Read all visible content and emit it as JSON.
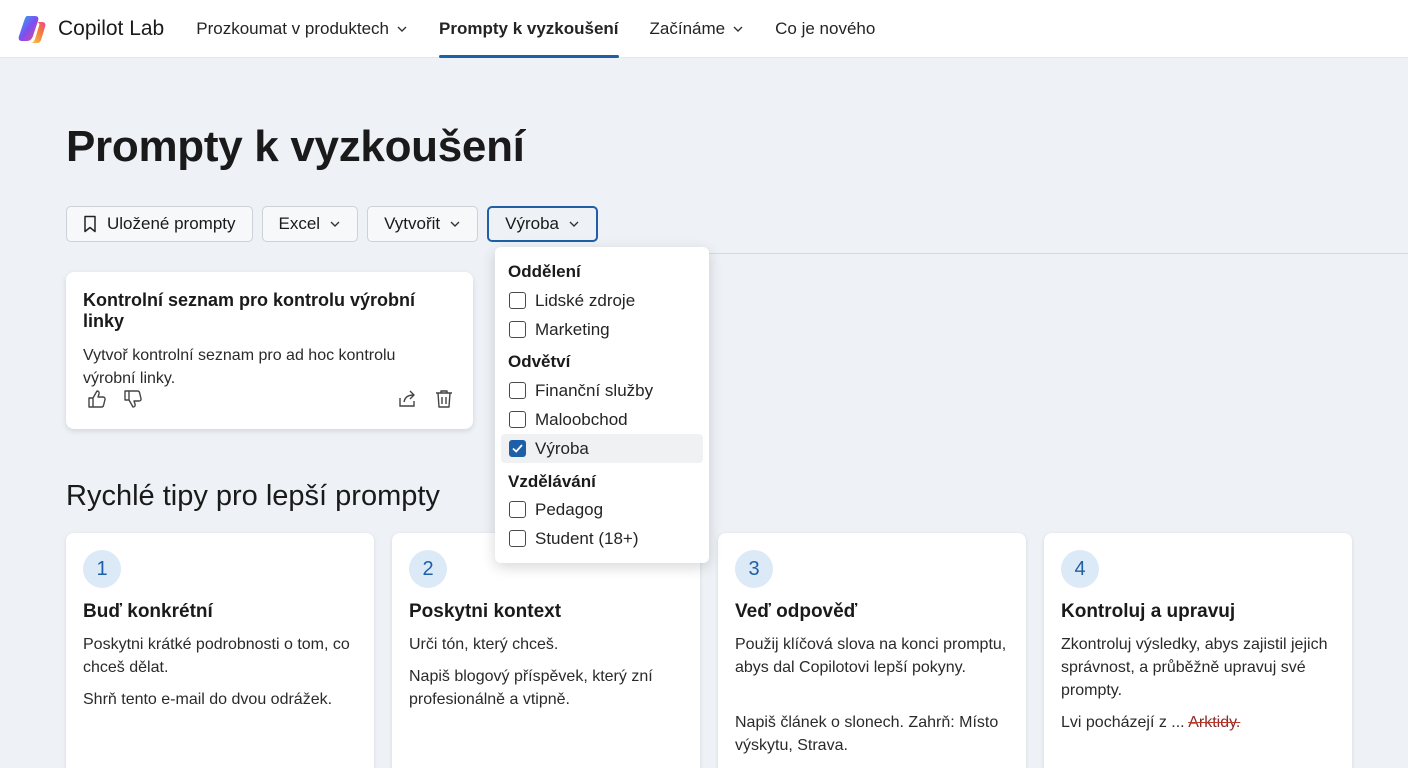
{
  "app": {
    "name": "Copilot Lab"
  },
  "nav": {
    "items": [
      {
        "label": "Prozkoumat v produktech",
        "has_menu": true,
        "active": false
      },
      {
        "label": "Prompty k vyzkoušení",
        "has_menu": false,
        "active": true
      },
      {
        "label": "Začínáme",
        "has_menu": true,
        "active": false
      },
      {
        "label": "Co je nového",
        "has_menu": false,
        "active": false
      }
    ]
  },
  "page": {
    "title": "Prompty k vyzkoušení"
  },
  "filters": {
    "saved_label": "Uložené prompty",
    "excel_label": "Excel",
    "create_label": "Vytvořit",
    "industry_label": "Výroba"
  },
  "dropdown": {
    "groups": [
      {
        "label": "Oddělení",
        "options": [
          {
            "label": "Lidské zdroje",
            "checked": false
          },
          {
            "label": "Marketing",
            "checked": false
          }
        ]
      },
      {
        "label": "Odvětví",
        "options": [
          {
            "label": "Finanční služby",
            "checked": false
          },
          {
            "label": "Maloobchod",
            "checked": false
          },
          {
            "label": "Výroba",
            "checked": true
          }
        ]
      },
      {
        "label": "Vzdělávání",
        "options": [
          {
            "label": "Pedagog",
            "checked": false
          },
          {
            "label": "Student (18+)",
            "checked": false
          }
        ]
      }
    ]
  },
  "prompt_card": {
    "title": "Kontrolní seznam pro kontrolu výrobní linky",
    "description": "Vytvoř kontrolní seznam pro ad hoc kontrolu výrobní linky."
  },
  "tips": {
    "title": "Rychlé tipy pro lepší prompty",
    "cards": [
      {
        "num": "1",
        "title": "Buď konkrétní",
        "text": "Poskytni krátké podrobnosti o tom, co chceš dělat.",
        "example": "Shrň tento e-mail do dvou odrážek."
      },
      {
        "num": "2",
        "title": "Poskytni kontext",
        "text": "Urči tón, který chceš.",
        "example": "Napiš blogový příspěvek, který zní profesionálně a vtipně."
      },
      {
        "num": "3",
        "title": "Veď odpověď",
        "text": "Použij klíčová slova na konci promptu, abys dal Copilotovi lepší pokyny.",
        "example": "Napiš článek o slonech. Zahrň: Místo výskytu, Strava."
      },
      {
        "num": "4",
        "title": "Kontroluj a upravuj",
        "text": "Zkontroluj výsledky, abys zajistil jejich správnost, a průběžně upravuj své prompty.",
        "example_prefix": "Lvi pocházejí z ... ",
        "example_struck": "Arktidy."
      }
    ]
  },
  "colors": {
    "accent": "#1f5fa8",
    "background": "#eef2f6",
    "strike": "#c0392b"
  },
  "icons": [
    "copilot-logo-icon",
    "chevron-down-icon",
    "bookmark-icon",
    "thumbs-up-icon",
    "thumbs-down-icon",
    "share-icon",
    "trash-icon",
    "checkmark-icon"
  ]
}
